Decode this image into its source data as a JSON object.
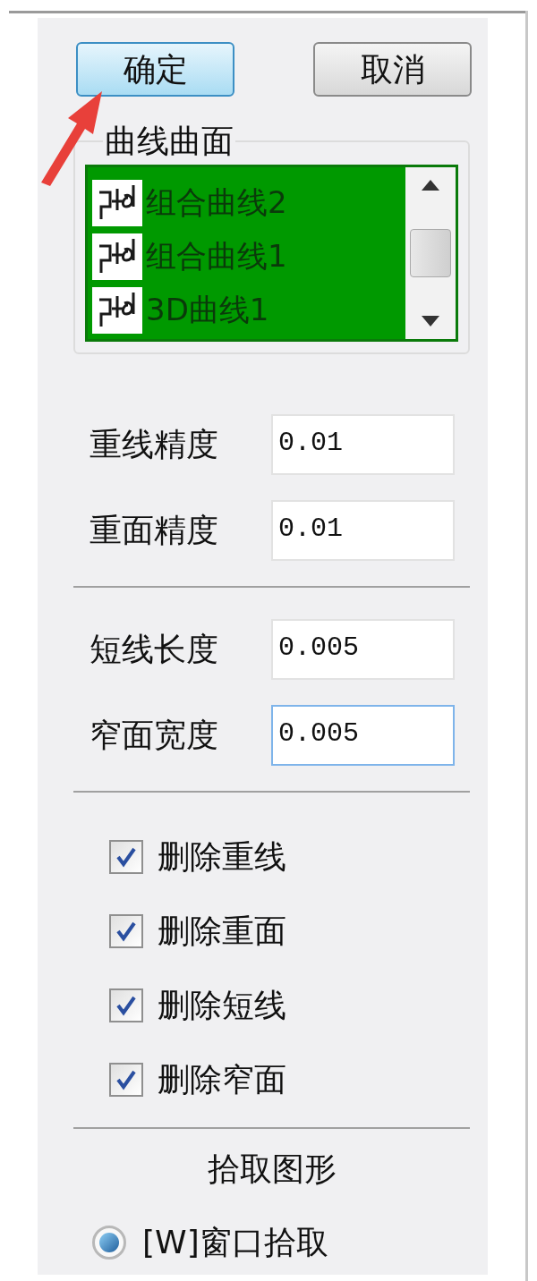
{
  "buttons": [
    {
      "label": "确定",
      "focused": true
    },
    {
      "label": "取消",
      "focused": false
    }
  ],
  "curves_group": {
    "title": "曲线曲面",
    "items": [
      {
        "label": "组合曲线2"
      },
      {
        "label": "组合曲线1"
      },
      {
        "label": "3D曲线1"
      }
    ]
  },
  "precision_fields": [
    {
      "label": "重线精度",
      "value": "0.01",
      "focused": false
    },
    {
      "label": "重面精度",
      "value": "0.01",
      "focused": false
    }
  ],
  "size_fields": [
    {
      "label": "短线长度",
      "value": "0.005",
      "focused": false
    },
    {
      "label": "窄面宽度",
      "value": "0.005",
      "focused": true
    }
  ],
  "checkboxes": [
    {
      "label": "删除重线",
      "checked": true
    },
    {
      "label": "删除重面",
      "checked": true
    },
    {
      "label": "删除短线",
      "checked": true
    },
    {
      "label": "删除窄面",
      "checked": true
    }
  ],
  "pick_section": {
    "title": "拾取图形",
    "options": [
      {
        "label": "[W]窗口拾取",
        "selected": true
      }
    ]
  }
}
